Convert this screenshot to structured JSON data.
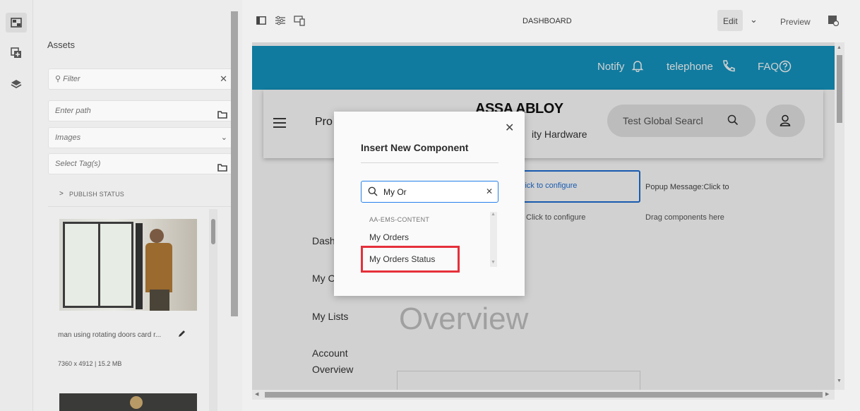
{
  "rail": {
    "icons": [
      "image-asset-icon",
      "add-components-icon",
      "layers-icon"
    ]
  },
  "assets": {
    "title": "Assets",
    "filter_placeholder": "Filter",
    "path_placeholder": "Enter path",
    "type_value": "Images",
    "tags_placeholder": "Select Tag(s)",
    "publish_status": "PUBLISH STATUS",
    "item_name": "man using rotating doors card r...",
    "item_meta": "7360 x 4912 | 15.2 MB"
  },
  "toolbar": {
    "title": "DASHBOARD",
    "edit": "Edit",
    "preview": "Preview"
  },
  "page": {
    "topbar": {
      "notify": "Notify",
      "telephone": "telephone",
      "faq": "FAQ",
      "color": "#1497c2"
    },
    "brand": "ASSA ABLOY",
    "brand_sub": "ity Hardware",
    "menu_partial": "Pro",
    "search_placeholder": "Test Global Searcl",
    "config_1": "lick to configure",
    "config_2": "Popup Message:Click to",
    "config_3": "Click to configure",
    "config_4": "Drag components here",
    "nav": [
      "Dash",
      "My C",
      "My Lists",
      "Account",
      "Overview"
    ],
    "bg_title_1": "Account",
    "bg_title_2": "Overview"
  },
  "dialog": {
    "title": "Insert New Component",
    "search_value": "My Or",
    "group": "AA-EMS-CONTENT",
    "items": [
      "My Orders",
      "My Orders Status"
    ],
    "highlight_color": "#e5303b"
  }
}
